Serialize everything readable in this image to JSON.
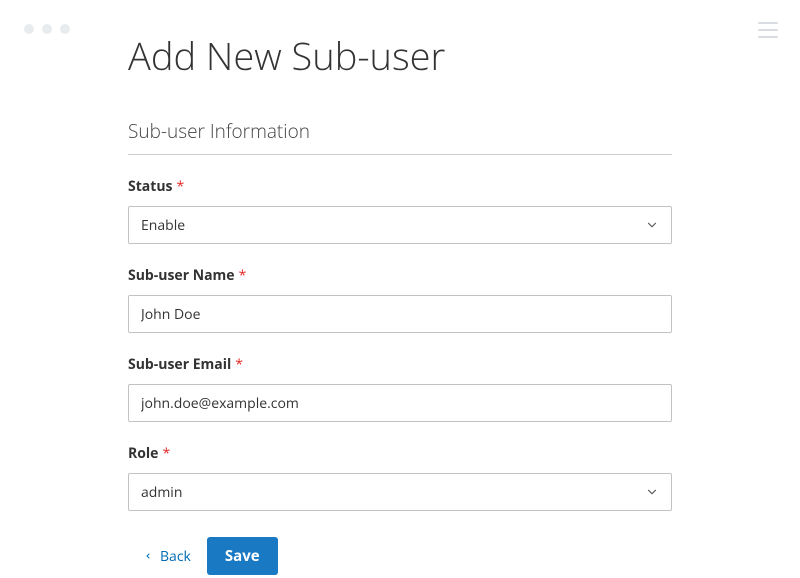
{
  "page": {
    "title": "Add New Sub-user",
    "section_title": "Sub-user Information"
  },
  "form": {
    "status": {
      "label": "Status",
      "value": "Enable"
    },
    "name": {
      "label": "Sub-user Name",
      "value": "John Doe"
    },
    "email": {
      "label": "Sub-user Email",
      "value": "john.doe@example.com"
    },
    "role": {
      "label": "Role",
      "value": "admin"
    }
  },
  "actions": {
    "back_label": "Back",
    "save_label": "Save"
  }
}
